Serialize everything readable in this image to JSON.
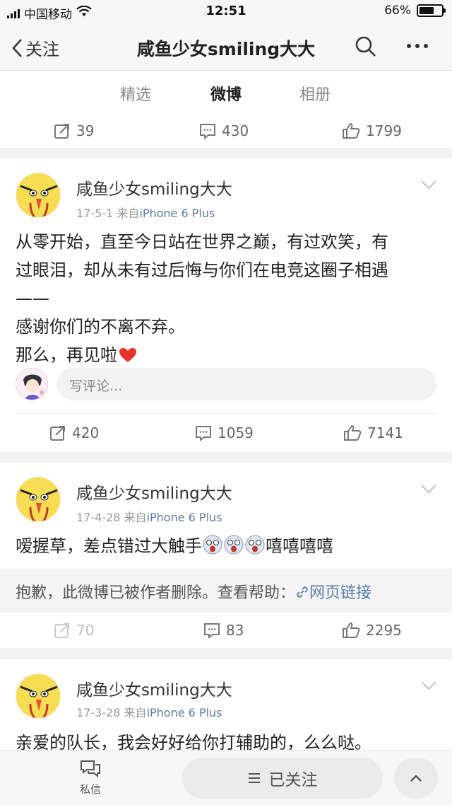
{
  "status_bar": {
    "carrier": "中国移动",
    "time": "12:51",
    "battery": "66%",
    "battery_level": 0.66
  },
  "nav": {
    "back_label": "关注",
    "title": "咸鱼少女smiling大大"
  },
  "tabs": [
    {
      "label": "精选",
      "active": false
    },
    {
      "label": "微博",
      "active": true
    },
    {
      "label": "相册",
      "active": false
    }
  ],
  "top_actions": {
    "repost": "39",
    "comment": "430",
    "like": "1799"
  },
  "posts": [
    {
      "user": "咸鱼少女smiling大大",
      "date": "17-5-1",
      "from": "来自",
      "source": "iPhone 6 Plus",
      "lines": [
        "从零开始，直至今日站在世界之巅，有过欢笑，有",
        "过眼泪，却从未有过后悔与你们在电竞这圈子相遇",
        "——",
        "感谢你们的不离不弃。",
        "那么，再见啦"
      ],
      "comment_placeholder": "写评论...",
      "repost": "420",
      "comment": "1059",
      "like": "7141"
    },
    {
      "user": "咸鱼少女smiling大大",
      "date": "17-4-28",
      "from": "来自",
      "source": "iPhone 6 Plus",
      "text_before": "嗳握草，差点错过大触手",
      "text_after": "嘻嘻嘻嘻",
      "deleted_msg": "抱歉，此微博已被作者删除。查看帮助：",
      "link_label": "网页链接",
      "repost": "70",
      "comment": "83",
      "like": "2295"
    },
    {
      "user": "咸鱼少女smiling大大",
      "date": "17-3-28",
      "from": "来自",
      "source": "iPhone 6 Plus",
      "text": "亲爱的队长，我会好好给你打辅助的，么么哒。"
    }
  ],
  "bottom_bar": {
    "message_label": "私信",
    "follow_label": "已关注"
  },
  "colors": {
    "accent": "#ff8200",
    "link": "#5b7ca8",
    "heart": "#e8322c"
  }
}
